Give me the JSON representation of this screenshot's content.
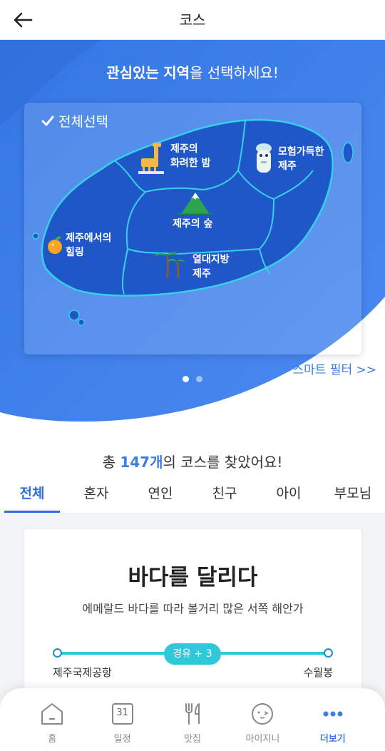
{
  "header": {
    "title": "코스"
  },
  "hero": {
    "question_bold_1": "관심있는",
    "question_bold_2": "지역",
    "question_rest": "을 선택하세요!",
    "select_all": "전체선택",
    "regions": [
      {
        "line1": "제주의",
        "line2": "화려한 밤",
        "icon": "giraffe-icon"
      },
      {
        "line1": "모험가득한",
        "line2": "제주",
        "icon": "stone-statue-icon"
      },
      {
        "line1": "제주의 숲",
        "line2": "",
        "icon": "mountain-icon"
      },
      {
        "line1": "제주에서의",
        "line2": "힐링",
        "icon": "tangerine-icon"
      },
      {
        "line1": "열대지방",
        "line2": "제주",
        "icon": "palm-tree-icon"
      }
    ],
    "carousel_page": 1,
    "carousel_total": 2,
    "smart_filter": "스마트 필터 >>"
  },
  "results": {
    "prefix": "총 ",
    "count": "147개",
    "suffix": "의 코스를 찾았어요!"
  },
  "tabs": [
    {
      "label": "전체",
      "active": true
    },
    {
      "label": "혼자",
      "active": false
    },
    {
      "label": "연인",
      "active": false
    },
    {
      "label": "친구",
      "active": false
    },
    {
      "label": "아이",
      "active": false
    },
    {
      "label": "부모님",
      "active": false
    }
  ],
  "course": {
    "title": "바다를 달리다",
    "description": "에메랄드 바다를 따라 볼거리 많은 서쪽 해안가",
    "waypoint": "경유 + 3",
    "start": "제주국제공항",
    "end": "수월봉"
  },
  "bottom_nav": [
    {
      "label": "홈",
      "icon": "home-icon",
      "active": false
    },
    {
      "label": "일정",
      "icon": "calendar-icon",
      "calendar_day": "31",
      "active": false
    },
    {
      "label": "맛집",
      "icon": "fork-knife-icon",
      "active": false
    },
    {
      "label": "마이지니",
      "icon": "face-icon",
      "active": false
    },
    {
      "label": "더보기",
      "icon": "more-dots-icon",
      "active": true
    }
  ],
  "colors": {
    "accent": "#3a7de8",
    "hero_bg": "#3d7fe6",
    "map_fill": "#1f56c8",
    "route": "#2ec8d8"
  }
}
